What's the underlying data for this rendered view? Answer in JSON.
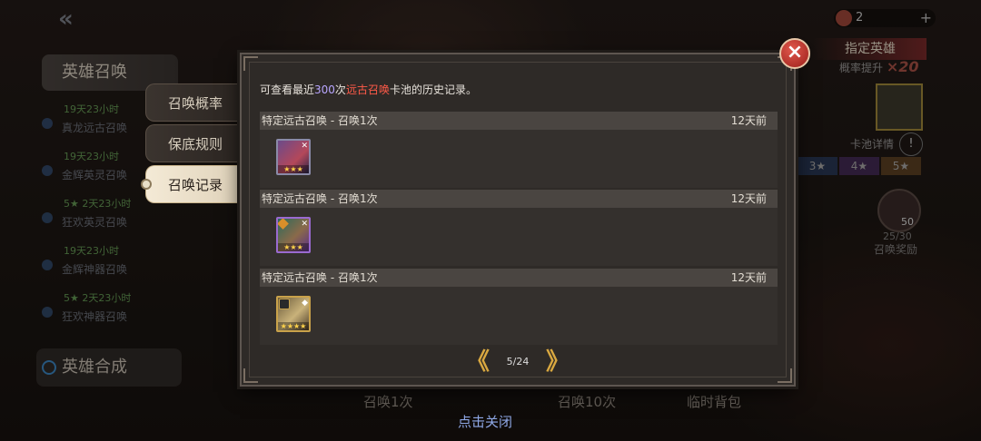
{
  "sidebar": {
    "title": "英雄召唤",
    "items": [
      {
        "timer": "19天23小时",
        "name": "真龙远古召唤"
      },
      {
        "timer": "19天23小时",
        "name": "金辉英灵召唤"
      },
      {
        "timer": "5★ 2天23小时",
        "name": "狂欢英灵召唤"
      },
      {
        "timer": "19天23小时",
        "name": "金辉神器召唤"
      },
      {
        "timer": "5★ 2天23小时",
        "name": "狂欢神器召唤"
      }
    ],
    "synthesis": "英雄合成"
  },
  "topbar": {
    "resource_count": "2",
    "plus": "+"
  },
  "right_panel": {
    "tag": "指定英雄",
    "rate_label": "概率提升",
    "rate_value": "×20",
    "pool_detail": "卡池详情",
    "pool_info": "!",
    "stars": [
      "3★",
      "4★",
      "5★"
    ],
    "reward_count": "50",
    "reward_progress": "25/30",
    "reward_label": "召唤奖励"
  },
  "bottom": {
    "summon1": "召唤1次",
    "summon10": "召唤10次",
    "bag": "临时背包",
    "close_hint": "点击关闭"
  },
  "tabs": [
    {
      "label": "召唤概率"
    },
    {
      "label": "保底规则"
    },
    {
      "label": "召唤记录"
    }
  ],
  "popup": {
    "intro_pre": "可查看最近",
    "intro_num": "300",
    "intro_mid": "次",
    "intro_pool": "远古召唤",
    "intro_post": "卡池的历史记录。",
    "records": [
      {
        "title": "特定远古召唤 - 召唤1次",
        "time": "12天前",
        "stars": "★★★"
      },
      {
        "title": "特定远古召唤 - 召唤1次",
        "time": "12天前",
        "stars": "★★★"
      },
      {
        "title": "特定远古召唤 - 召唤1次",
        "time": "12天前",
        "stars": "★★★★"
      }
    ],
    "page": "5/24",
    "prev": "《",
    "next": "》",
    "close": "×"
  }
}
